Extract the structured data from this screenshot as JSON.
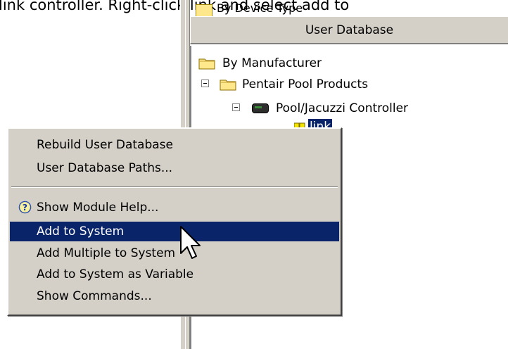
{
  "caption": "link controller. Right-click link and select add to",
  "top_partial_label": "By Device Type",
  "column_header": "User Database",
  "tree": [
    {
      "label": "By Manufacturer"
    },
    {
      "label": "Pentair Pool Products"
    },
    {
      "label": "Pool/Jacuzzi Controller"
    },
    {
      "label": "link"
    }
  ],
  "context_menu": {
    "items": [
      {
        "label": "Rebuild User Database"
      },
      {
        "label": "User Database Paths..."
      },
      {
        "label": "Show Module Help..."
      },
      {
        "label": "Add to System"
      },
      {
        "label": "Add Multiple to System"
      },
      {
        "label": "Add to System as Variable"
      },
      {
        "label": "Show Commands..."
      }
    ],
    "highlighted_item": "Add to System"
  },
  "colors": {
    "selection": "#0a246a",
    "menu_bg": "#d4d0c8",
    "folder": "#ffe88c"
  },
  "icons": [
    "folder-icon",
    "device-icon",
    "help-icon",
    "arrow-cursor-icon"
  ]
}
